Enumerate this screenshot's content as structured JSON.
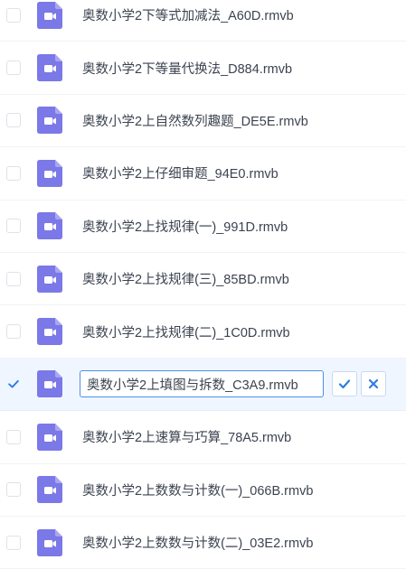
{
  "files": [
    {
      "name": "奥数小学2下等式加减法_A60D.rmvb",
      "checked": false,
      "editing": false
    },
    {
      "name": "奥数小学2下等量代换法_D884.rmvb",
      "checked": false,
      "editing": false
    },
    {
      "name": "奥数小学2上自然数列趣题_DE5E.rmvb",
      "checked": false,
      "editing": false
    },
    {
      "name": "奥数小学2上仔细审题_94E0.rmvb",
      "checked": false,
      "editing": false
    },
    {
      "name": "奥数小学2上找规律(一)_991D.rmvb",
      "checked": false,
      "editing": false
    },
    {
      "name": "奥数小学2上找规律(三)_85BD.rmvb",
      "checked": false,
      "editing": false
    },
    {
      "name": "奥数小学2上找规律(二)_1C0D.rmvb",
      "checked": false,
      "editing": false
    },
    {
      "name": "奥数小学2上填图与拆数_C3A9.rmvb",
      "checked": true,
      "editing": true
    },
    {
      "name": "奥数小学2上速算与巧算_78A5.rmvb",
      "checked": false,
      "editing": false
    },
    {
      "name": "奥数小学2上数数与计数(一)_066B.rmvb",
      "checked": false,
      "editing": false
    },
    {
      "name": "奥数小学2上数数与计数(二)_03E2.rmvb",
      "checked": false,
      "editing": false
    }
  ],
  "icons": {
    "file_type": "video-file-icon",
    "confirm": "check-icon",
    "cancel": "close-icon"
  },
  "colors": {
    "video_icon": "#7b78e8",
    "accent": "#2f7de1",
    "selected_row": "#f0f6ff"
  }
}
